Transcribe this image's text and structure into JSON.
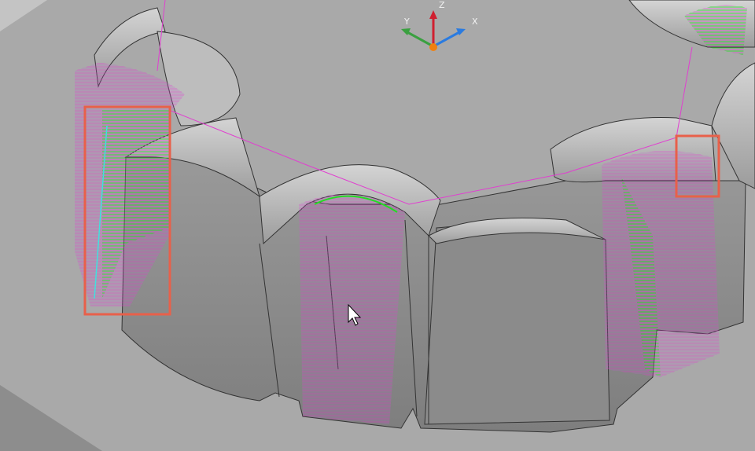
{
  "viewport": {
    "triad": {
      "x_label": "X",
      "y_label": "Y",
      "z_label": "Z"
    },
    "colors": {
      "background": "#a7a7a7",
      "highlight_box": "#e8604a",
      "toolpath_green": "#22dd22",
      "toolpath_pink": "#e040d0",
      "toolpath_cyan": "#40e0e0",
      "axis_x": "#2a7be0",
      "axis_y": "#3aa040",
      "axis_z": "#d02030"
    },
    "highlight_boxes": 2
  }
}
